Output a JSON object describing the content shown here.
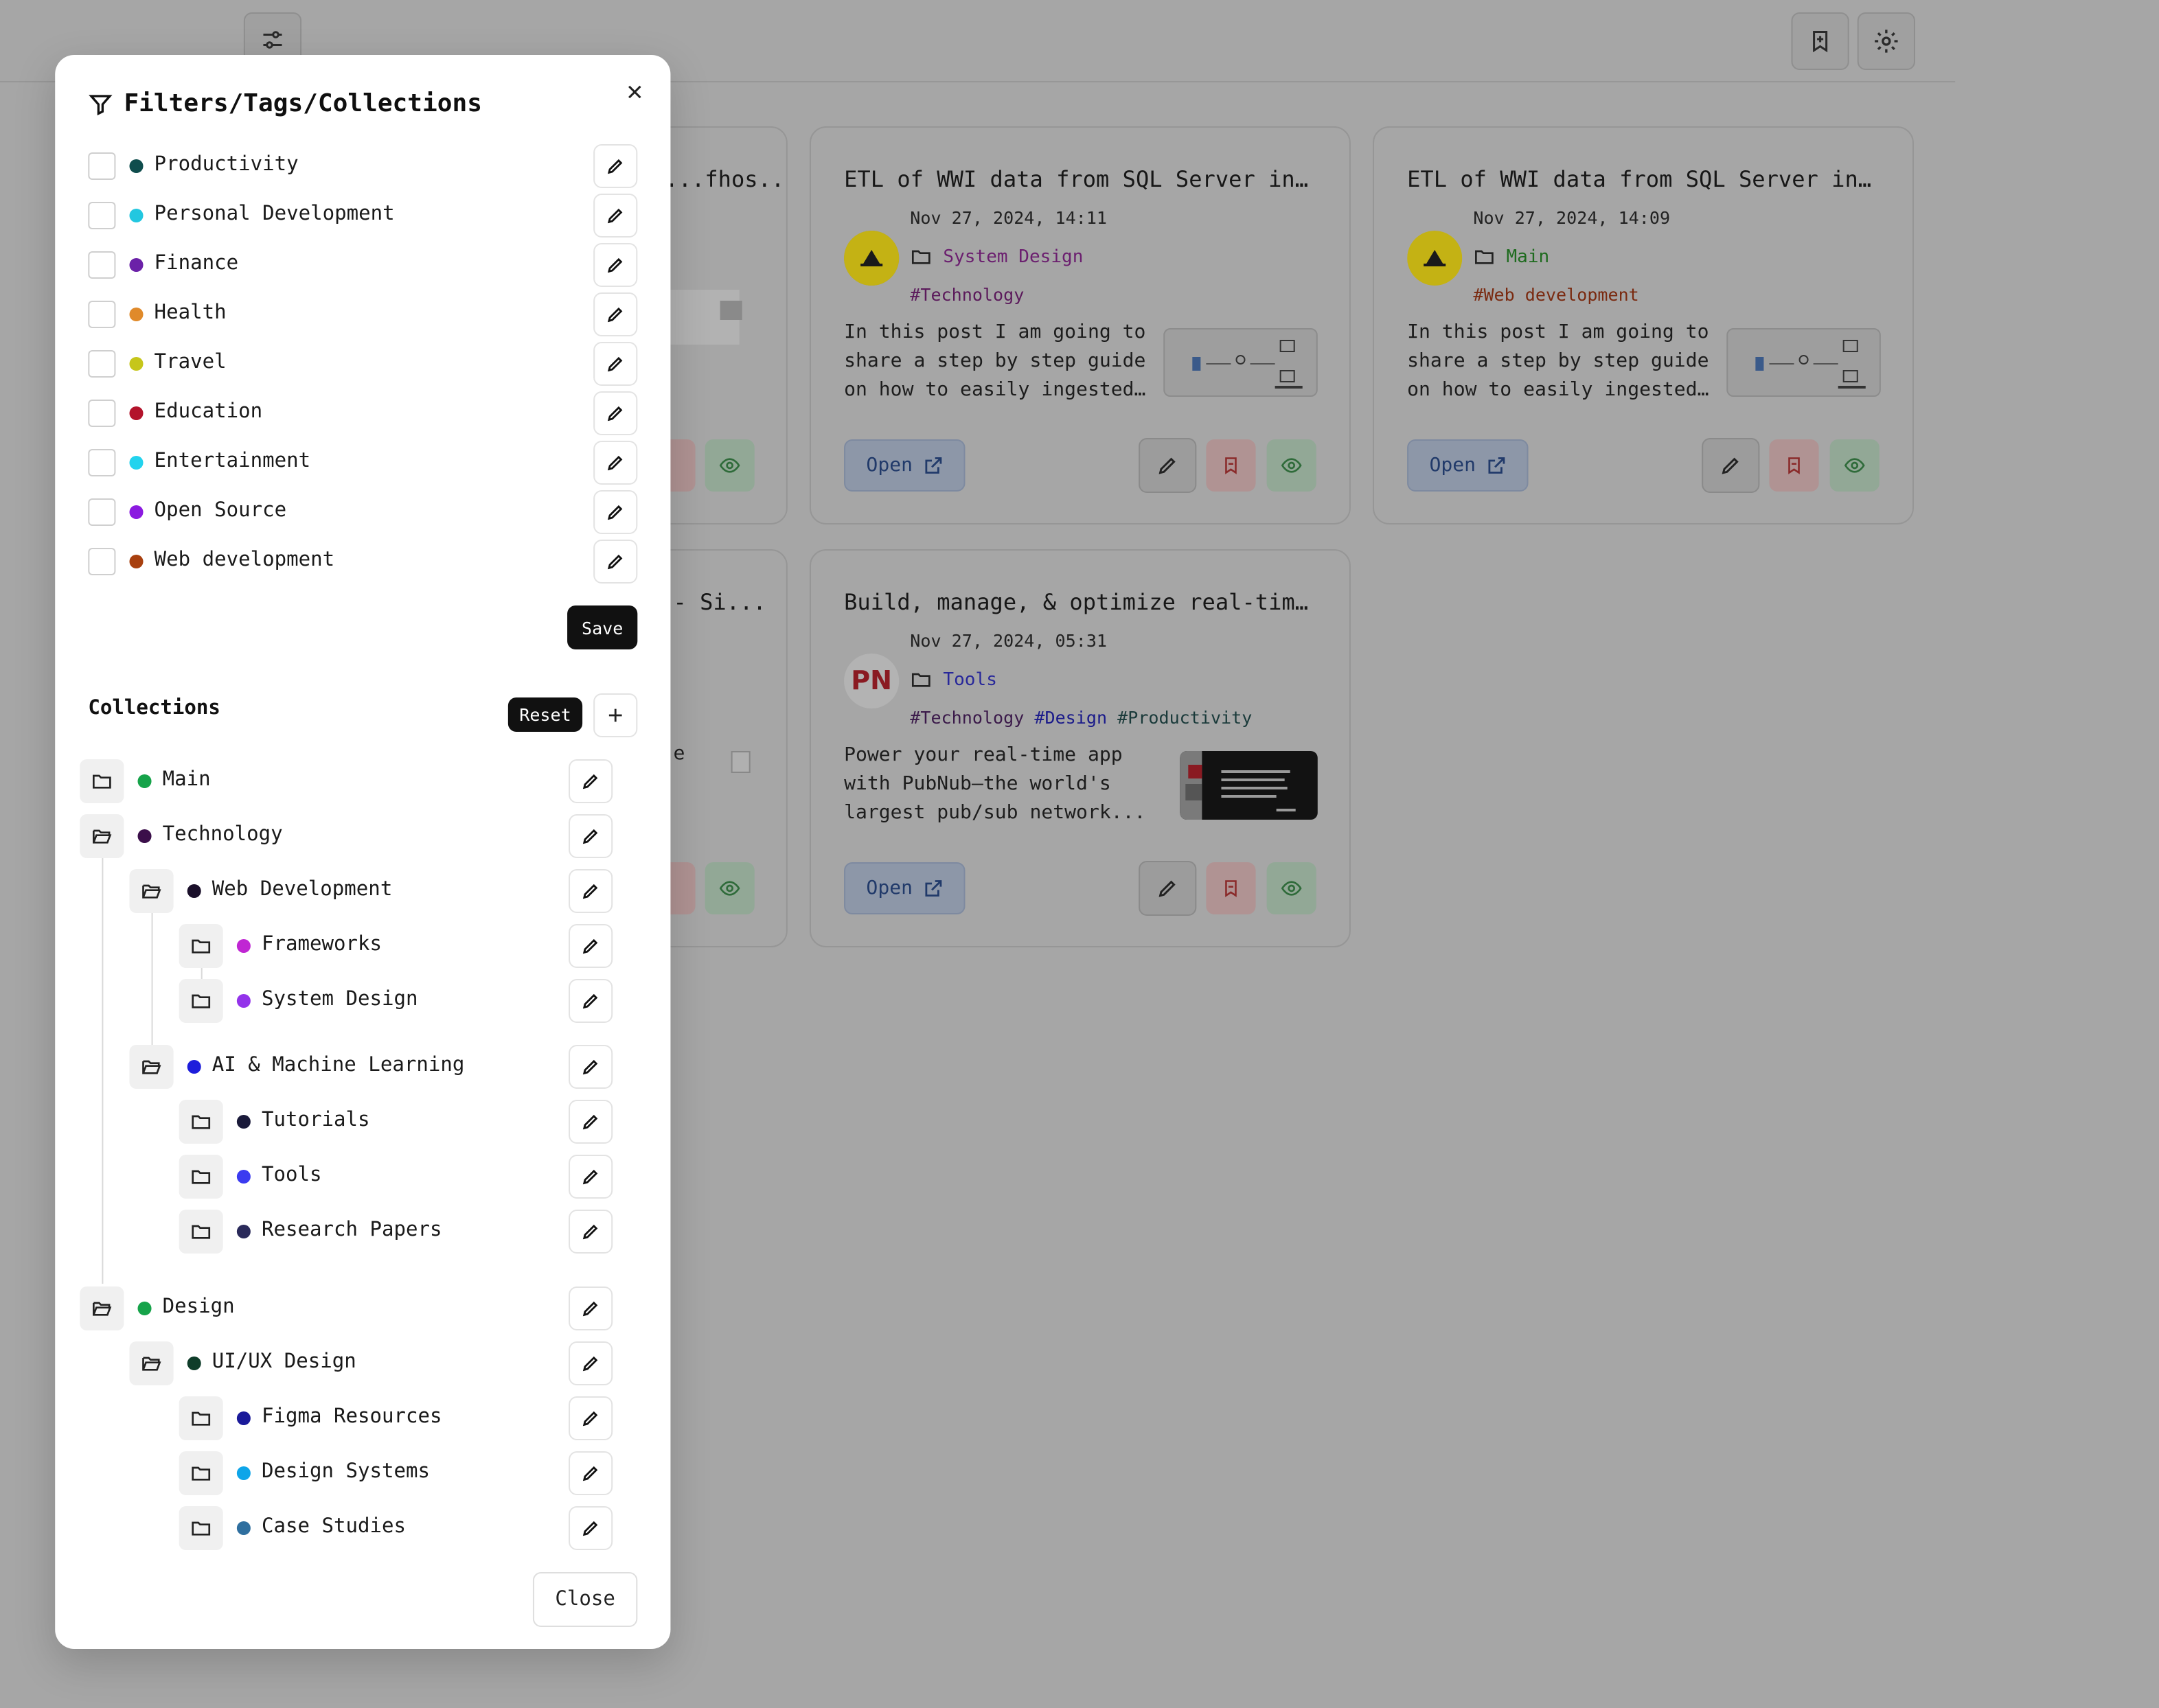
{
  "app": {
    "topbar": {
      "filter_icon": "sliders-icon",
      "bookmark_add_icon": "bookmark-plus-icon",
      "settings_icon": "gear-icon"
    },
    "cards": [
      {
        "title": "...fhos...",
        "partial": true
      },
      {
        "title": "ETL of WWI data from SQL Server in...",
        "date": "Nov 27, 2024, 14:11",
        "collection": "System Design",
        "collection_color": "#6b1f6f",
        "tags": [
          "#Technology"
        ],
        "description": [
          "In this post I am going to",
          "share a step by step guide",
          "on how to easily ingested..."
        ],
        "open_label": "Open"
      },
      {
        "title": "ETL of WWI data from SQL Server in...",
        "date": "Nov 27, 2024, 14:09",
        "collection": "Main",
        "collection_color": "#1f6b1f",
        "tags": [
          "#Web development"
        ],
        "description": [
          "In this post I am going to",
          "share a step by step guide",
          "on how to easily ingested..."
        ],
        "open_label": "Open"
      },
      {
        "title": "- Si...",
        "partial": true,
        "desc_fragment": "e"
      },
      {
        "title": "Build, manage, & optimize real-tim...",
        "date": "Nov 27, 2024, 05:31",
        "collection": "Tools",
        "collection_color": "#28289a",
        "avatar_text": "PN",
        "tags": [
          "#Technology",
          "#Design",
          "#Productivity"
        ],
        "description": [
          "Power your real-time app",
          "with PubNub—the world's",
          "largest pub/sub network..."
        ],
        "open_label": "Open"
      }
    ]
  },
  "modal": {
    "title": "Filters/Tags/Collections",
    "tags": [
      {
        "name": "Productivity",
        "color": "#0f4d4d"
      },
      {
        "name": "Personal Development",
        "color": "#22c7e0"
      },
      {
        "name": "Finance",
        "color": "#6b21a8"
      },
      {
        "name": "Health",
        "color": "#e08a2a"
      },
      {
        "name": "Travel",
        "color": "#c6c61a"
      },
      {
        "name": "Education",
        "color": "#b3132b"
      },
      {
        "name": "Entertainment",
        "color": "#22d3ee"
      },
      {
        "name": "Open Source",
        "color": "#8b1ae0"
      },
      {
        "name": "Web development",
        "color": "#a8400f"
      }
    ],
    "save_label": "Save",
    "collections_heading": "Collections",
    "reset_label": "Reset",
    "collections": [
      {
        "name": "Main",
        "color": "#16a34a",
        "open": false
      },
      {
        "name": "Technology",
        "color": "#3b0f4a",
        "open": true
      },
      {
        "name": "Web Development",
        "color": "#1a0f2a",
        "open": true
      },
      {
        "name": "Frameworks",
        "color": "#c026d3",
        "open": false
      },
      {
        "name": "System Design",
        "color": "#9333ea",
        "open": false
      },
      {
        "name": "AI & Machine Learning",
        "color": "#1d1ddb",
        "open": true
      },
      {
        "name": "Tutorials",
        "color": "#1a1a3a",
        "open": false
      },
      {
        "name": "Tools",
        "color": "#3b3bf0",
        "open": false
      },
      {
        "name": "Research Papers",
        "color": "#2a2a5a",
        "open": false
      },
      {
        "name": "Design",
        "color": "#16a34a",
        "open": true
      },
      {
        "name": "UI/UX Design",
        "color": "#0f3d2a",
        "open": true
      },
      {
        "name": "Figma Resources",
        "color": "#1a1a9a",
        "open": false
      },
      {
        "name": "Design Systems",
        "color": "#0ea5e9",
        "open": false
      },
      {
        "name": "Case Studies",
        "color": "#2f6f9f",
        "open": false
      }
    ],
    "close_label": "Close"
  }
}
